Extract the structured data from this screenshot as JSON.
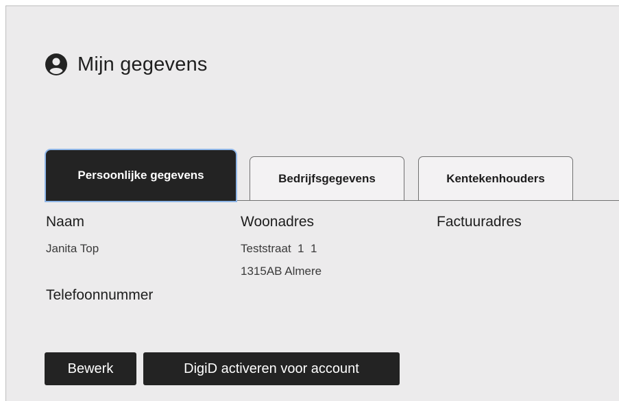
{
  "page": {
    "title": "Mijn gegevens",
    "icon": "user-circle-icon"
  },
  "tabs": [
    {
      "label": "Persoonlijke gegevens",
      "active": true
    },
    {
      "label": "Bedrijfsgegevens",
      "active": false
    },
    {
      "label": "Kentekenhouders",
      "active": false
    }
  ],
  "fields": {
    "naam": {
      "label": "Naam",
      "value": "Janita Top"
    },
    "woonadres": {
      "label": "Woonadres",
      "line1": "Teststraat  1  1",
      "line2": "1315AB Almere"
    },
    "factuuradres": {
      "label": "Factuuradres"
    },
    "telefoonnummer": {
      "label": "Telefoonnummer"
    }
  },
  "actions": {
    "edit_label": "Bewerk",
    "digid_label": "DigiD activeren voor account"
  },
  "colors": {
    "background": "#ecebec",
    "dark": "#232323",
    "focus_ring": "#8fb6e8"
  }
}
